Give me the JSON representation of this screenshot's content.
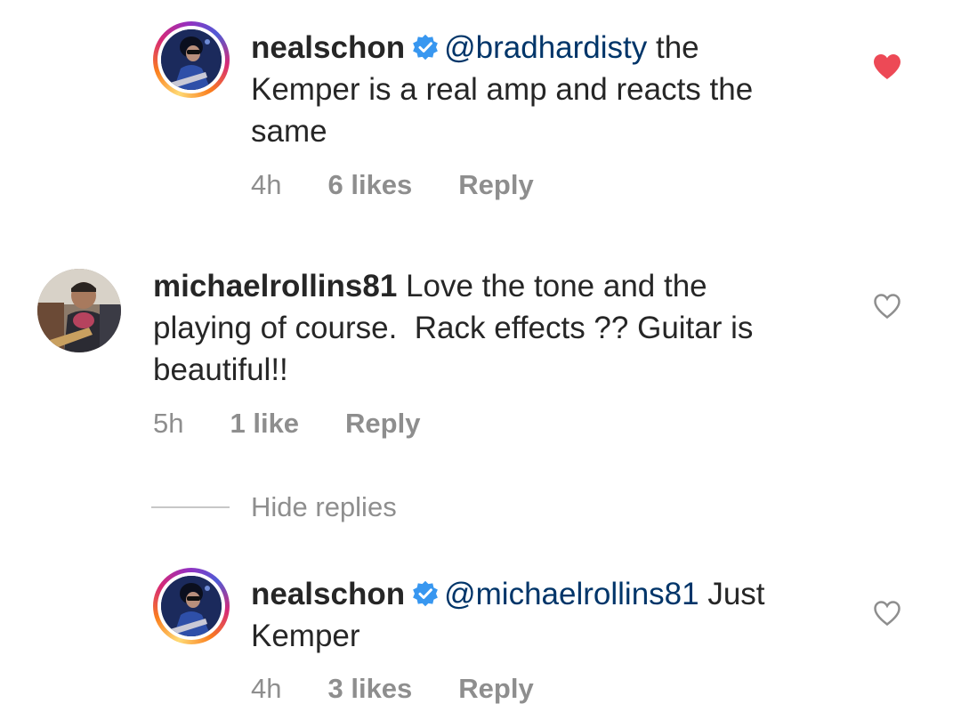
{
  "comments": [
    {
      "username": "nealschon",
      "verified": true,
      "mention": "@bradhardisty",
      "line1_rest": " the",
      "line2": "Kemper is a real amp and reacts the",
      "line3": "same",
      "time": "4h",
      "likes": "6 likes",
      "reply": "Reply",
      "liked": true
    },
    {
      "username": "michaelrollins81",
      "line1_rest": " Love the tone and the",
      "line2": "playing of course.  Rack effects ?? Guitar is",
      "line3": "beautiful!!",
      "time": "5h",
      "likes": "1 like",
      "reply": "Reply",
      "liked": false
    },
    {
      "username": "nealschon",
      "verified": true,
      "mention": "@michaelrollins81",
      "line1_rest": " Just",
      "line2": "Kemper",
      "time": "4h",
      "likes": "3 likes",
      "reply": "Reply",
      "liked": false
    }
  ],
  "hide_replies": "Hide replies",
  "colors": {
    "heart_liked": "#ed4956",
    "heart_outline": "#8e8e8e",
    "verified_blue": "#3897f0",
    "mention": "#003569",
    "meta_gray": "#8e8e8e"
  },
  "icons": {
    "verified": "verified-badge-icon",
    "heart_filled": "heart-filled-icon",
    "heart_outline": "heart-outline-icon"
  }
}
